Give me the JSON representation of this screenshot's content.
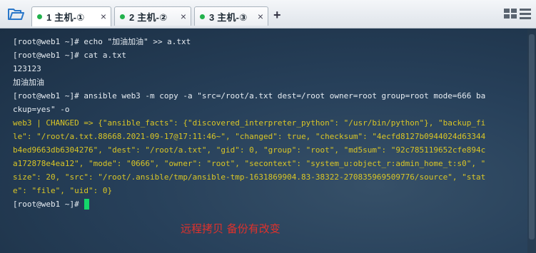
{
  "tabs": [
    {
      "label": "1 主机-①",
      "active": true
    },
    {
      "label": "2 主机-②",
      "active": false
    },
    {
      "label": "3 主机-③",
      "active": false
    }
  ],
  "tab_close_glyph": "×",
  "add_tab_glyph": "+",
  "icons": [
    "folder-icon",
    "grid-view-icon",
    "menu-icon",
    "close-icon",
    "plus-icon"
  ],
  "colors": {
    "status_dot": "#22b14c",
    "output_yellow": "#d9c526",
    "cursor": "#14d66a",
    "annotation": "#e0312b"
  },
  "terminal": {
    "lines": [
      {
        "text": "[root@web1 ~]# echo \"加油加油\" >> a.txt",
        "style": "normal"
      },
      {
        "text": "[root@web1 ~]# cat a.txt",
        "style": "normal"
      },
      {
        "text": "123123",
        "style": "normal"
      },
      {
        "text": "加油加油",
        "style": "normal"
      },
      {
        "text": "[root@web1 ~]# ansible web3 -m copy -a \"src=/root/a.txt dest=/root owner=root group=root mode=666 ba",
        "style": "normal"
      },
      {
        "text": "ckup=yes\" -o",
        "style": "normal"
      },
      {
        "text": "web3 | CHANGED => {\"ansible_facts\": {\"discovered_interpreter_python\": \"/usr/bin/python\"}, \"backup_fi",
        "style": "yellow"
      },
      {
        "text": "le\": \"/root/a.txt.88668.2021-09-17@17:11:46~\", \"changed\": true, \"checksum\": \"4ecfd8127b0944024d63344",
        "style": "yellow"
      },
      {
        "text": "b4ed9663db6304276\", \"dest\": \"/root/a.txt\", \"gid\": 0, \"group\": \"root\", \"md5sum\": \"92c785119652cfe894c",
        "style": "yellow"
      },
      {
        "text": "a172878e4ea12\", \"mode\": \"0666\", \"owner\": \"root\", \"secontext\": \"system_u:object_r:admin_home_t:s0\", \"",
        "style": "yellow"
      },
      {
        "text": "size\": 20, \"src\": \"/root/.ansible/tmp/ansible-tmp-1631869904.83-38322-270835969509776/source\", \"stat",
        "style": "yellow"
      },
      {
        "text": "e\": \"file\", \"uid\": 0}",
        "style": "yellow"
      }
    ],
    "prompt": "[root@web1 ~]#"
  },
  "annotation": "远程拷贝 备份有改变"
}
